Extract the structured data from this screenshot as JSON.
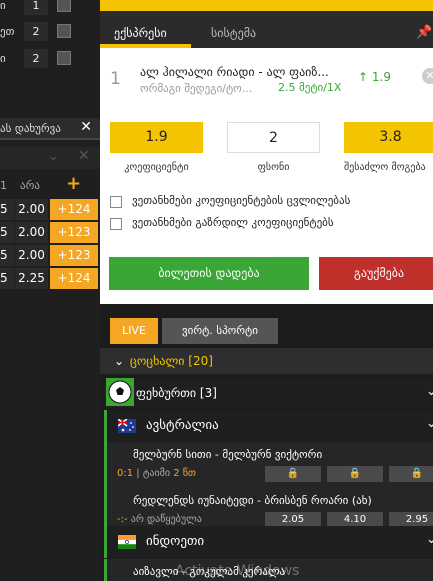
{
  "left_panel": {
    "top_rows": [
      {
        "text": "ი",
        "num": "1"
      },
      {
        "text": "ეთ",
        "num": "2"
      },
      {
        "text": "ი",
        "num": "2"
      }
    ],
    "tab_label": "ას დახურვა",
    "headers": {
      "col1": "1",
      "col2": "არა",
      "plus": "+"
    },
    "odds_rows": [
      {
        "a": "5",
        "b": "2.00",
        "c": "+124"
      },
      {
        "a": "5",
        "b": "2.00",
        "c": "+123"
      },
      {
        "a": "5",
        "b": "2.00",
        "c": "+123"
      },
      {
        "a": "5",
        "b": "2.25",
        "c": "+124"
      }
    ]
  },
  "betslip": {
    "tabs": {
      "express": "ექსპრესი",
      "system": "სისტემა"
    },
    "bet": {
      "index": "1",
      "title": "ალ ჰილალი რიადი - ალ ფაიზ...",
      "subtitle": "ორმაგი შედეგი/ტო...",
      "selection": "2.5 მეტი/1X",
      "odds_arrow": "↑",
      "odds": "1.9"
    },
    "boxes": [
      {
        "value": "1.9",
        "label": "კოეფიციენტი"
      },
      {
        "value": "2",
        "label": "ფსონი"
      },
      {
        "value": "3.8",
        "label": "შესაძლო მოგება"
      }
    ],
    "checkboxes": [
      "ვეთანხმები კოეფიციენტების ცვლილებას",
      "ვეთანხმები გაზრდილ კოეფიციენტებს"
    ],
    "place_label": "ბილეთის დადება",
    "cancel_label": "გაუქმება"
  },
  "live": {
    "tab_live": "LIVE",
    "tab_virtual": "ვირტ. სპორტი",
    "section_title": "ცოცხალი [20]",
    "sport": "ფეხბურთი [3]",
    "countries": [
      {
        "name": "ავსტრალია"
      },
      {
        "name": "ინდოეთი"
      }
    ],
    "matches": [
      {
        "teams": "მელბურნ სითი - მელბურნ ვიქტორი",
        "score": "0:1",
        "period": " | ტაიმი ",
        "minute": "2 წთ",
        "odds": [
          "",
          "",
          ""
        ]
      },
      {
        "teams": "რედლენდს იუნაიტედი - ბრისბენ როარი (ახ)",
        "score": "-:-",
        "period": " არ დაწყებულა",
        "minute": "",
        "odds": [
          "2.05",
          "4.10",
          "2.95"
        ]
      },
      {
        "teams": "აიზავლი - გოკულამ კერალა",
        "score": "",
        "period": "",
        "minute": "",
        "odds": []
      }
    ]
  },
  "watermark": "Activate Windows",
  "colors": {
    "yellow": "#f5c400",
    "orange": "#f5a623",
    "green": "#3aa635",
    "red": "#c0302a"
  }
}
